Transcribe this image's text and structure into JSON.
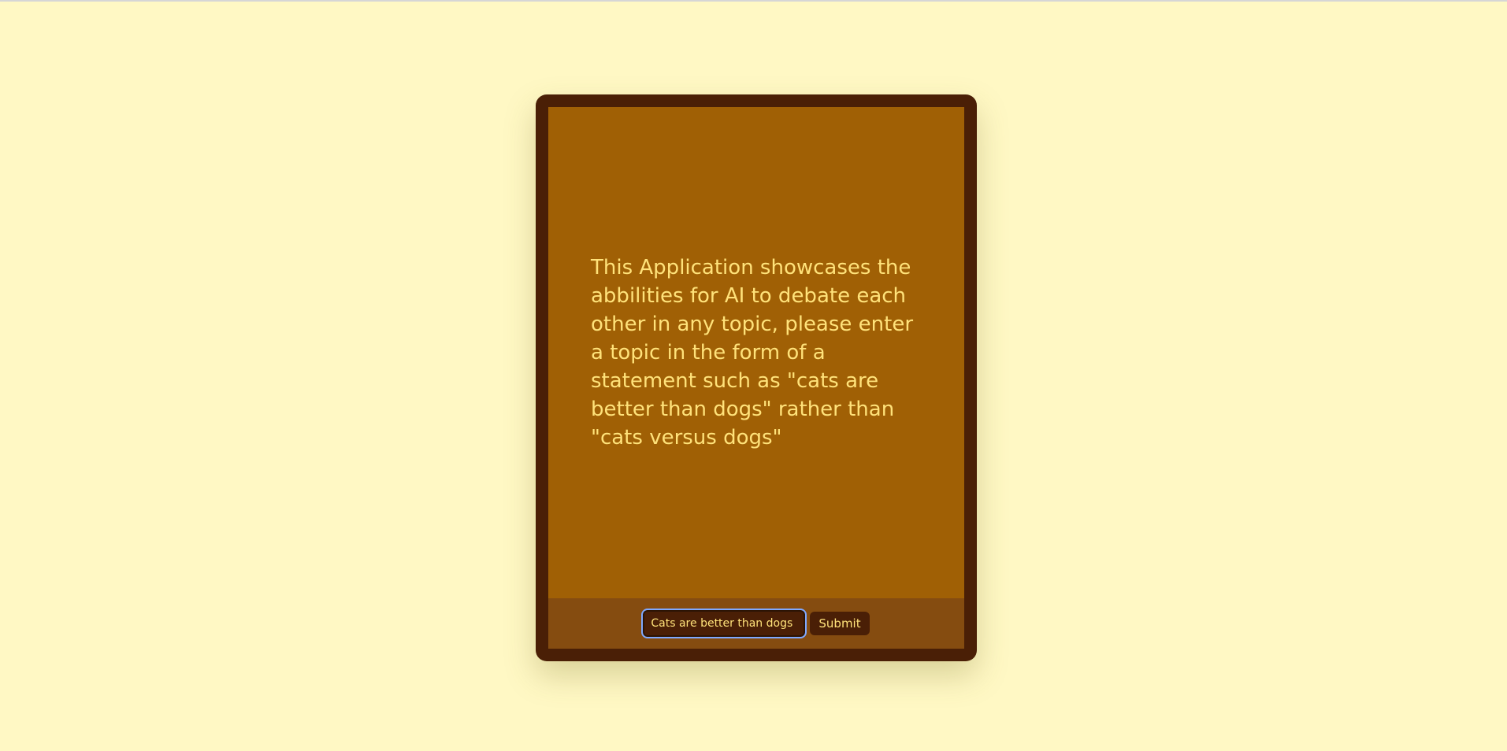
{
  "intro": {
    "text": "This Application showcases the abbilities for AI to debate each other in any topic, please enter a topic in the form of a statement such as \"cats are better than dogs\" rather than \"cats versus dogs\""
  },
  "form": {
    "topic_value": "Cats are better than dogs",
    "submit_label": "Submit"
  },
  "colors": {
    "page_background": "#fff8c4",
    "frame": "#4a1f06",
    "screen": "#a06005",
    "input_bar": "#854c10",
    "text": "#ffe27a",
    "focus_ring": "#7fa8ff"
  }
}
